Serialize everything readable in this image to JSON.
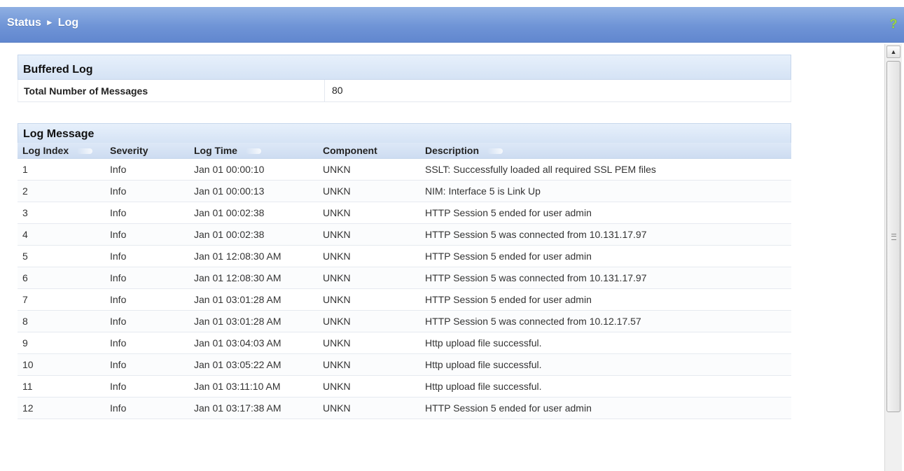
{
  "header": {
    "breadcrumb": [
      "Status",
      "Log"
    ],
    "separator": "►",
    "help_icon": "?"
  },
  "buffered_log": {
    "title": "Buffered Log",
    "total_label": "Total Number of Messages",
    "total_value": "80"
  },
  "log_message": {
    "title": "Log Message",
    "columns": [
      "Log Index",
      "Severity",
      "Log Time",
      "Component",
      "Description"
    ],
    "rows": [
      {
        "index": "1",
        "severity": "Info",
        "time": "Jan 01 00:00:10",
        "component": "UNKN",
        "description": "SSLT: Successfully loaded all required SSL PEM files"
      },
      {
        "index": "2",
        "severity": "Info",
        "time": "Jan 01 00:00:13",
        "component": "UNKN",
        "description": "NIM: Interface 5 is Link Up"
      },
      {
        "index": "3",
        "severity": "Info",
        "time": "Jan 01 00:02:38",
        "component": "UNKN",
        "description": "HTTP Session 5 ended for user admin"
      },
      {
        "index": "4",
        "severity": "Info",
        "time": "Jan 01 00:02:38",
        "component": "UNKN",
        "description": "HTTP Session 5 was connected from 10.131.17.97"
      },
      {
        "index": "5",
        "severity": "Info",
        "time": "Jan 01 12:08:30 AM",
        "component": "UNKN",
        "description": "HTTP Session 5 ended for user admin"
      },
      {
        "index": "6",
        "severity": "Info",
        "time": "Jan 01 12:08:30 AM",
        "component": "UNKN",
        "description": "HTTP Session 5 was connected from 10.131.17.97"
      },
      {
        "index": "7",
        "severity": "Info",
        "time": "Jan 01 03:01:28 AM",
        "component": "UNKN",
        "description": "HTTP Session 5 ended for user admin"
      },
      {
        "index": "8",
        "severity": "Info",
        "time": "Jan 01 03:01:28 AM",
        "component": "UNKN",
        "description": "HTTP Session 5 was connected from 10.12.17.57"
      },
      {
        "index": "9",
        "severity": "Info",
        "time": "Jan 01 03:04:03 AM",
        "component": "UNKN",
        "description": "Http upload file successful."
      },
      {
        "index": "10",
        "severity": "Info",
        "time": "Jan 01 03:05:22 AM",
        "component": "UNKN",
        "description": "Http upload file successful."
      },
      {
        "index": "11",
        "severity": "Info",
        "time": "Jan 01 03:11:10 AM",
        "component": "UNKN",
        "description": "Http upload file successful."
      },
      {
        "index": "12",
        "severity": "Info",
        "time": "Jan 01 03:17:38 AM",
        "component": "UNKN",
        "description": "HTTP Session 5 ended for user admin"
      }
    ]
  },
  "colors": {
    "titlebar": "#6f94d6",
    "section_header": "#d5e3f5",
    "help_icon": "#9bd34a"
  }
}
